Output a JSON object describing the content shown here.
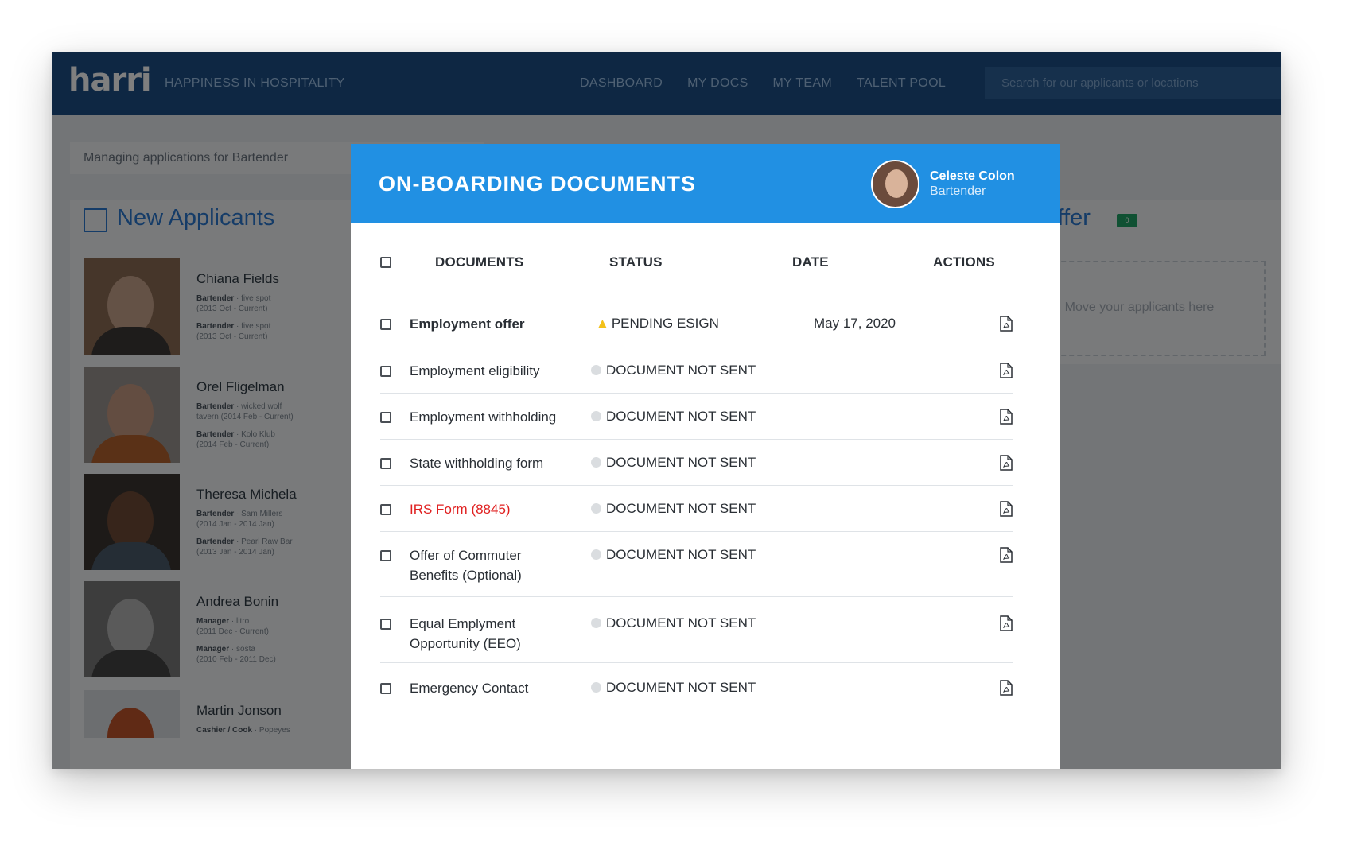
{
  "app": {
    "logo": "harri",
    "tagline": "HAPPINESS IN HOSPITALITY",
    "nav": [
      "DASHBOARD",
      "MY DOCS",
      "MY TEAM",
      "TALENT POOL"
    ],
    "search_placeholder": "Search for our applicants or locations"
  },
  "background": {
    "manage_text": "Managing applications for Bartender",
    "new_applicants_title": "New Applicants",
    "offer_title": "Offer",
    "offer_count": "0",
    "dropzone_text": "Move your applicants here",
    "applicants": [
      {
        "name": "Chiana Fields",
        "line1_role": "Bartender",
        "line1_rest": " · five spot",
        "line2": "(2013 Oct - Current)",
        "line3_role": "Bartender",
        "line3_rest": " · five spot",
        "line4": "(2013 Oct - Current)"
      },
      {
        "name": "Orel Fligelman",
        "line1_role": "Bartender",
        "line1_rest": " · wicked wolf",
        "line2": "tavern (2014 Feb - Current)",
        "line3_role": "Bartender",
        "line3_rest": " · Kolo Klub",
        "line4": "(2014 Feb - Current)"
      },
      {
        "name": "Theresa Michela",
        "line1_role": "Bartender",
        "line1_rest": " · Sam Millers",
        "line2": "(2014 Jan - 2014 Jan)",
        "line3_role": "Bartender",
        "line3_rest": " · Pearl Raw Bar",
        "line4": "(2013 Jan - 2014 Jan)"
      },
      {
        "name": "Andrea Bonin",
        "line1_role": "Manager",
        "line1_rest": " · litro",
        "line2": "(2011 Dec - Current)",
        "line3_role": "Manager",
        "line3_rest": " · sosta",
        "line4": "(2010 Feb - 2011 Dec)"
      },
      {
        "name": "Martin Jonson",
        "line1_role": "Cashier / Cook",
        "line1_rest": " · Popeyes",
        "line2": "",
        "line3_role": "",
        "line3_rest": "",
        "line4": ""
      }
    ]
  },
  "modal": {
    "title": "ON-BOARDING DOCUMENTS",
    "user": {
      "name": "Celeste Colon",
      "role": "Bartender"
    },
    "columns": {
      "documents": "DOCUMENTS",
      "status": "STATUS",
      "date": "DATE",
      "actions": "ACTIONS"
    },
    "rows": [
      {
        "doc": "Employment offer",
        "status": "PENDING ESIGN",
        "date": "May 17, 2020"
      },
      {
        "doc": "Employment eligibility",
        "status": "DOCUMENT NOT SENT",
        "date": ""
      },
      {
        "doc": "Employment withholding",
        "status": "DOCUMENT NOT SENT",
        "date": ""
      },
      {
        "doc": "State withholding form",
        "status": "DOCUMENT NOT SENT",
        "date": ""
      },
      {
        "doc": "IRS Form (8845)",
        "status": "DOCUMENT NOT SENT",
        "date": ""
      },
      {
        "doc": "Offer of Commuter Benefits (Optional)",
        "status": "DOCUMENT NOT SENT",
        "date": ""
      },
      {
        "doc": "Equal Emplyment Opportunity (EEO)",
        "status": "DOCUMENT NOT SENT",
        "date": ""
      },
      {
        "doc": "Emergency Contact",
        "status": "DOCUMENT NOT SENT",
        "date": ""
      }
    ]
  },
  "colors": {
    "header_blue": "#2190e3",
    "nav_blue": "#1c4f86",
    "warning": "#f3c11a",
    "error_red": "#e02020",
    "offer_badge": "#21a366"
  }
}
